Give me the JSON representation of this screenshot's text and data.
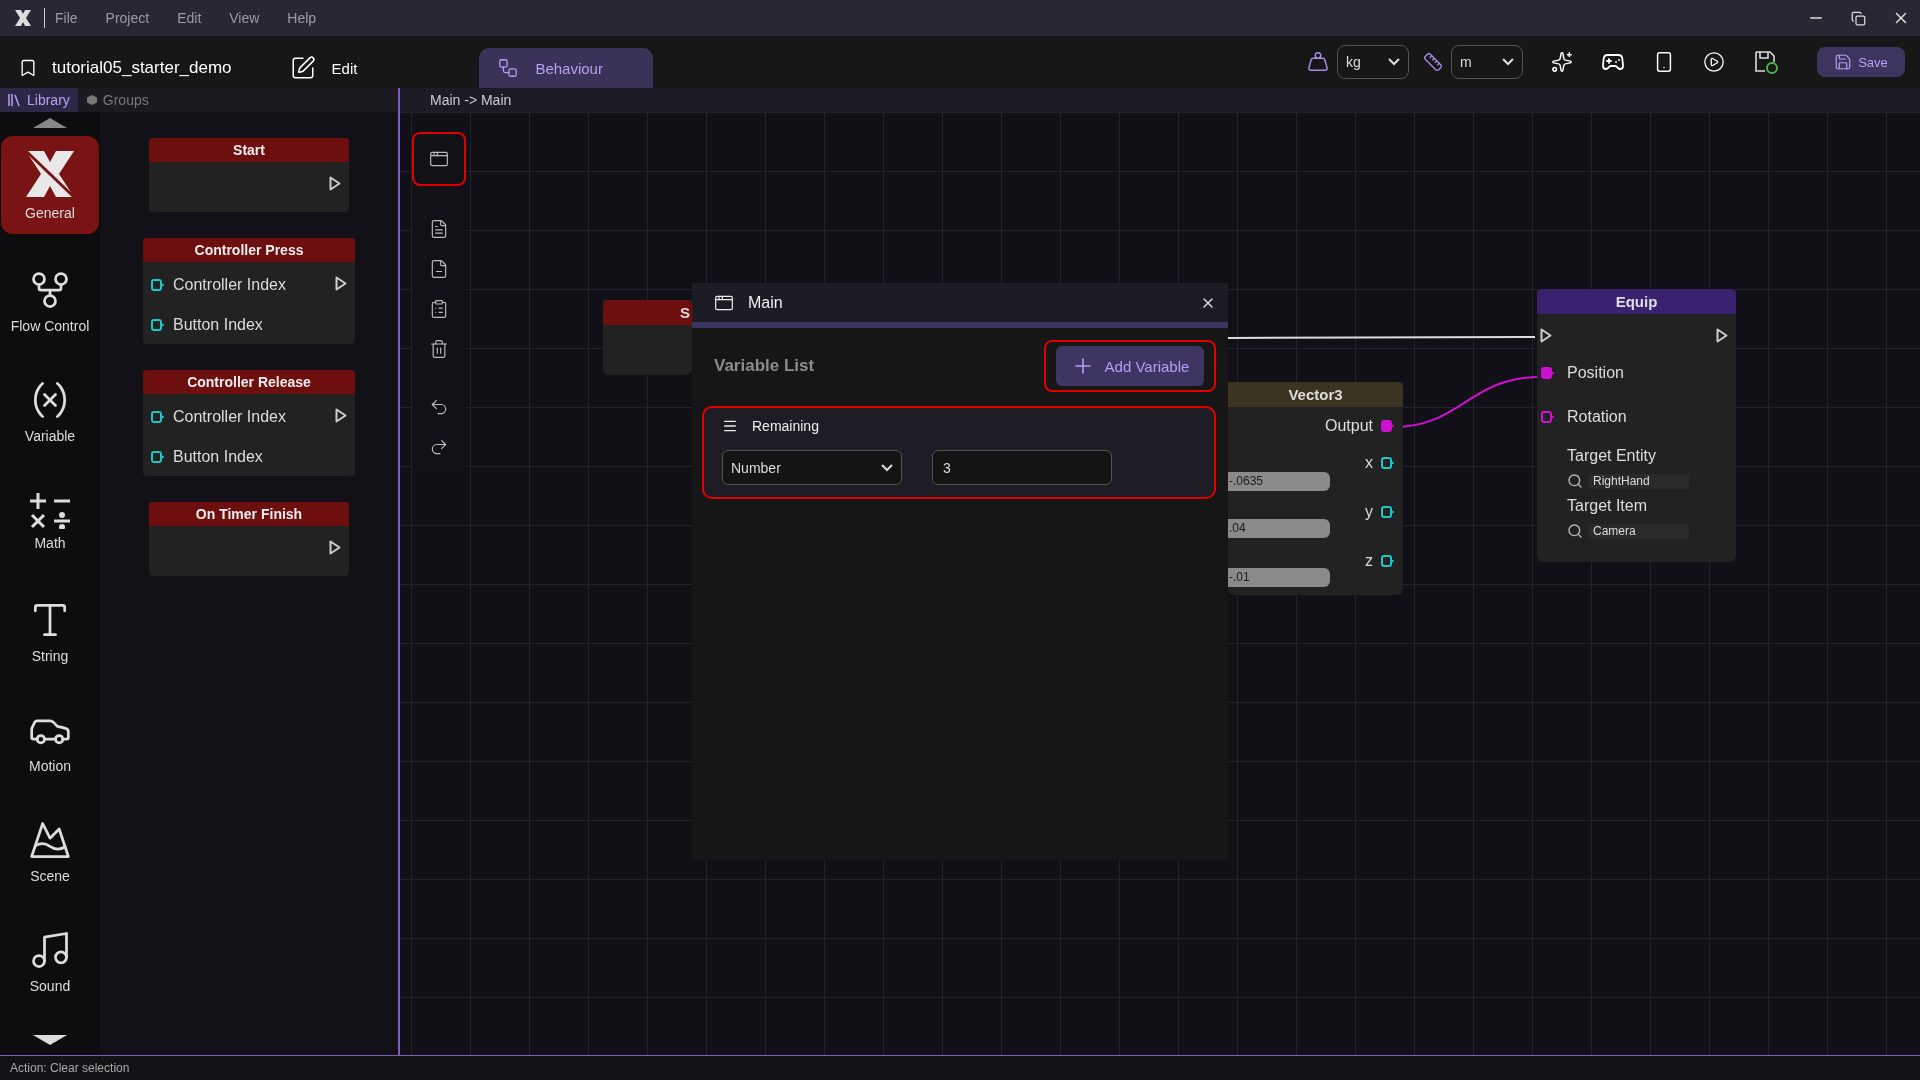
{
  "title_bar": {
    "menu": [
      "File",
      "Project",
      "Edit",
      "View",
      "Help"
    ]
  },
  "toolbar": {
    "project_name": "tutorial05_starter_demo",
    "mode_tabs": [
      {
        "label": "Edit",
        "selected": false
      },
      {
        "label": "Behaviour",
        "selected": true
      }
    ],
    "mass_unit": "kg",
    "length_unit": "m",
    "save_label": "Save"
  },
  "library": {
    "tabs": [
      {
        "label": "Library",
        "selected": true
      },
      {
        "label": "Groups",
        "selected": false
      }
    ],
    "categories": [
      {
        "label": "General",
        "selected": true
      },
      {
        "label": "Flow Control",
        "selected": false
      },
      {
        "label": "Variable",
        "selected": false
      },
      {
        "label": "Math",
        "selected": false
      },
      {
        "label": "String",
        "selected": false
      },
      {
        "label": "Motion",
        "selected": false
      },
      {
        "label": "Scene",
        "selected": false
      },
      {
        "label": "Sound",
        "selected": false
      }
    ],
    "nodes": [
      {
        "title": "Start"
      },
      {
        "title": "Controller Press",
        "inputs": [
          "Controller Index",
          "Button Index"
        ]
      },
      {
        "title": "Controller Release",
        "inputs": [
          "Controller Index",
          "Button Index"
        ]
      },
      {
        "title": "On Timer Finish"
      }
    ]
  },
  "canvas": {
    "breadcrumb": "Main -> Main",
    "tools": [
      {
        "kind": "variables",
        "highlighted": true
      },
      {
        "kind": "copy",
        "highlighted": false
      },
      {
        "kind": "cut",
        "highlighted": false
      },
      {
        "kind": "paste",
        "highlighted": false
      },
      {
        "kind": "delete",
        "highlighted": false
      },
      {
        "kind": "undo",
        "highlighted": false
      },
      {
        "kind": "redo",
        "highlighted": false
      }
    ],
    "partial_node": {
      "title": "S"
    },
    "vector3_node": {
      "title": "Vector3",
      "output": "Output",
      "inputs": [
        {
          "value": "-.0635",
          "output": "x"
        },
        {
          "value": ".04",
          "output": "y"
        },
        {
          "value": "-.01",
          "output": "z"
        }
      ]
    },
    "equip_node": {
      "title": "Equip",
      "ports": [
        {
          "label": "Position",
          "connected": true
        },
        {
          "label": "Rotation",
          "connected": false
        }
      ],
      "targets": [
        {
          "label": "Target Entity",
          "value": "RightHand"
        },
        {
          "label": "Target Item",
          "value": "Camera"
        }
      ]
    }
  },
  "dialog": {
    "title": "Main",
    "heading": "Variable List",
    "add_button": {
      "label": "Add Variable",
      "highlighted": true
    },
    "variables": [
      {
        "name": "Remaining",
        "type": "Number",
        "value": "3",
        "highlighted": true
      }
    ]
  },
  "status_bar": "Action: Clear selection"
}
